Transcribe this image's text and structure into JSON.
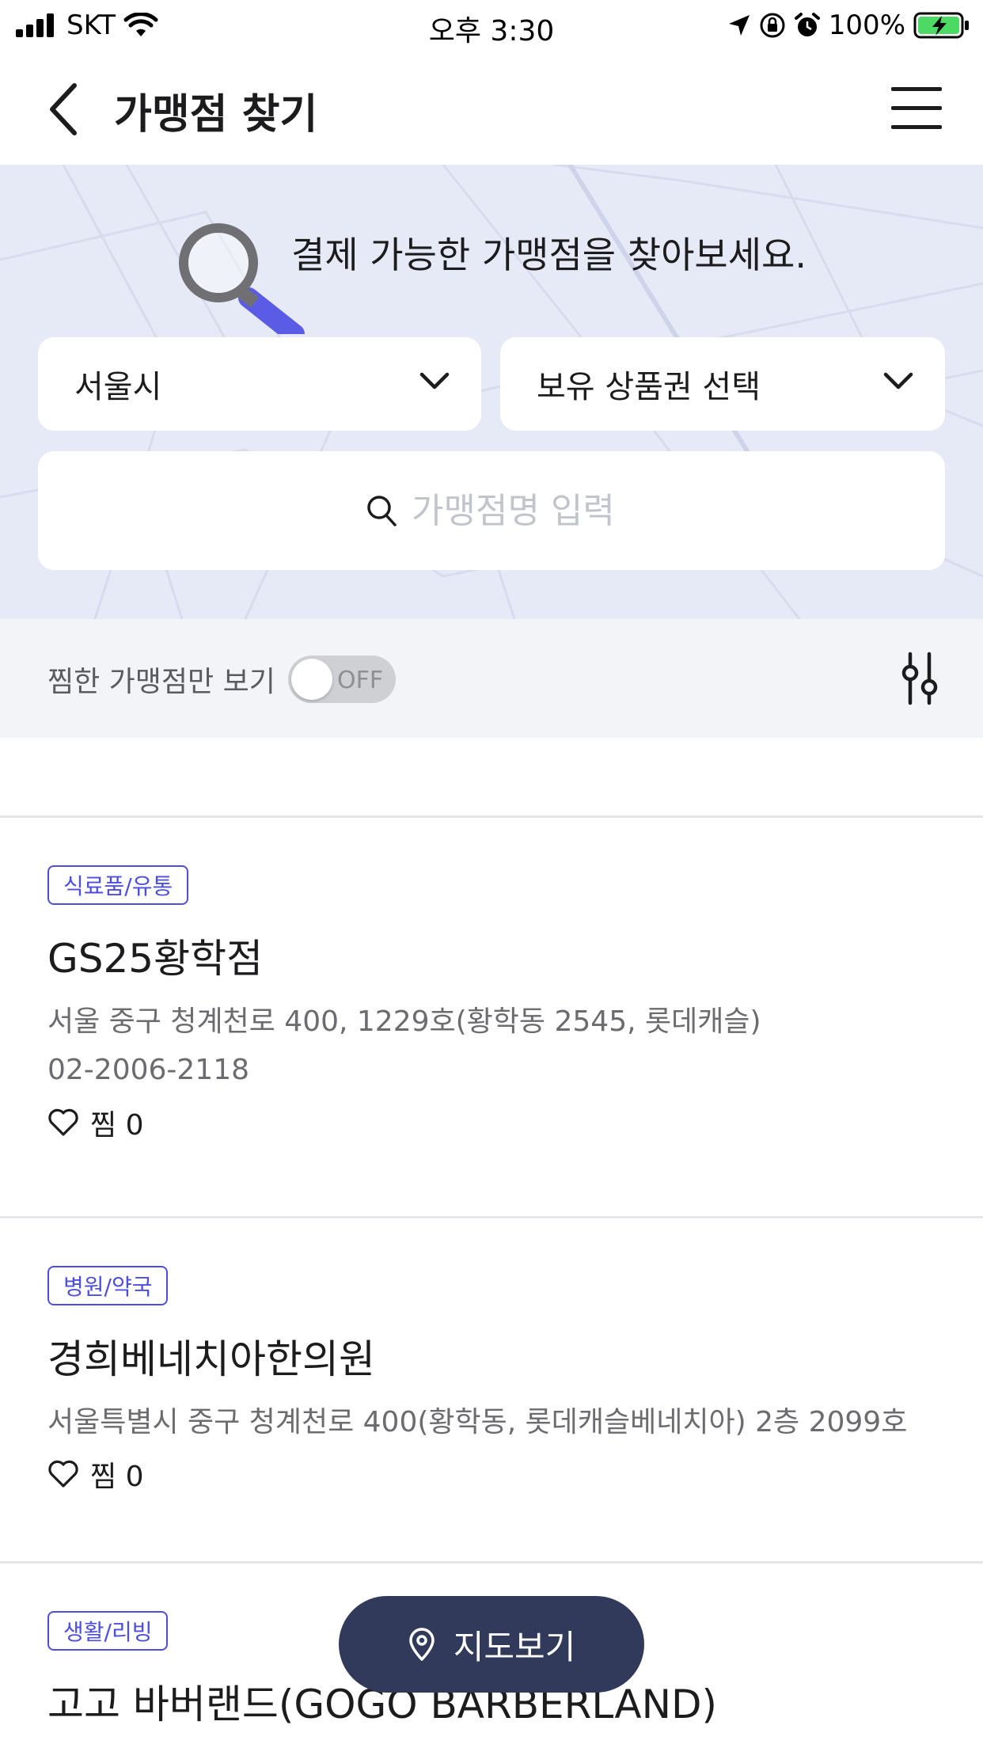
{
  "status_bar": {
    "carrier": "SKT",
    "time": "오후 3:30",
    "battery": "100%"
  },
  "header": {
    "title": "가맹점 찾기"
  },
  "hero": {
    "headline": "결제 가능한 가맹점을 찾아보세요.",
    "region_select": "서울시",
    "voucher_select": "보유 상품권 선택",
    "search_placeholder": "가맹점명 입력"
  },
  "filter": {
    "favorites_label": "찜한 가맹점만 보기",
    "toggle_state": "OFF"
  },
  "stores": [
    {
      "category": "식료품/유통",
      "name": "GS25황학점",
      "address": "서울 중구 청계천로 400, 1229호(황학동 2545, 롯데캐슬)",
      "phone": "02-2006-2118",
      "fav_label": "찜 0"
    },
    {
      "category": "병원/약국",
      "name": "경희베네치아한의원",
      "address": "서울특별시 중구 청계천로 400(황학동, 롯데캐슬베네치아) 2층 2099호",
      "fav_label": "찜 0"
    },
    {
      "category": "생활/리빙",
      "name": "고고 바버랜드(GOGO BARBERLAND)"
    }
  ],
  "map_button": {
    "label": "지도보기"
  },
  "colors": {
    "accent": "#4c4ee0",
    "hero_bg": "#e6e9f6",
    "map_button_bg": "#323a5c",
    "battery_green": "#4cd964"
  }
}
